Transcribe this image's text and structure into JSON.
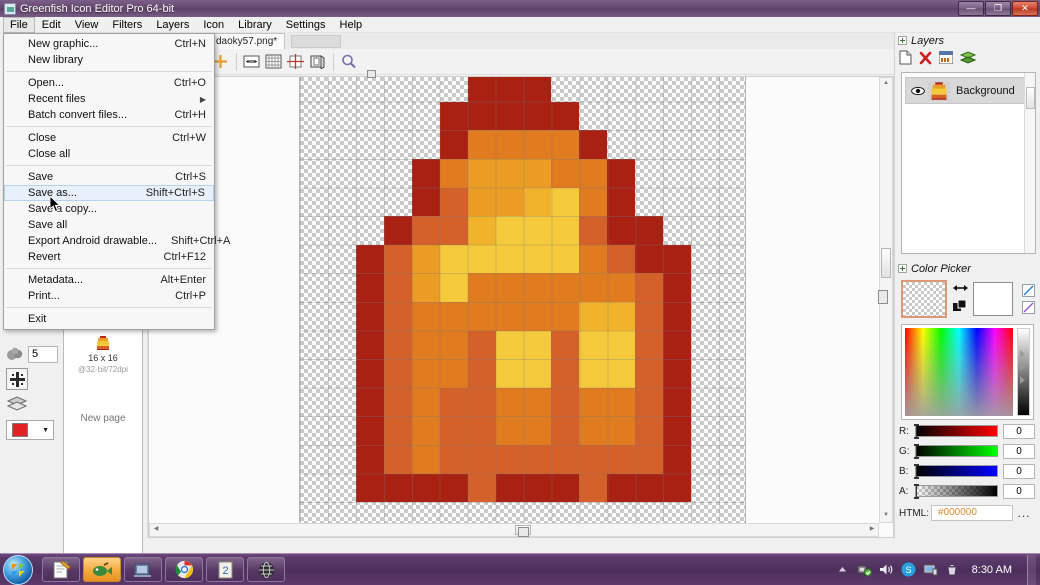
{
  "window": {
    "title": "Greenfish Icon Editor Pro 64-bit",
    "icon": "app-icon",
    "buttons": {
      "minimize": "—",
      "maximize": "❐",
      "close": "✕"
    }
  },
  "menubar": {
    "items": [
      {
        "label": "File",
        "active": true
      },
      {
        "label": "Edit",
        "active": false
      },
      {
        "label": "View",
        "active": false
      },
      {
        "label": "Filters",
        "active": false
      },
      {
        "label": "Layers",
        "active": false
      },
      {
        "label": "Icon",
        "active": false
      },
      {
        "label": "Library",
        "active": false
      },
      {
        "label": "Settings",
        "active": false
      },
      {
        "label": "Help",
        "active": false
      }
    ]
  },
  "file_menu": {
    "groups": [
      [
        {
          "label": "New graphic...",
          "shortcut": "Ctrl+N"
        },
        {
          "label": "New library",
          "shortcut": ""
        }
      ],
      [
        {
          "label": "Open...",
          "shortcut": "Ctrl+O"
        },
        {
          "label": "Recent files",
          "shortcut": "",
          "submenu": true
        },
        {
          "label": "Batch convert files...",
          "shortcut": "Ctrl+H"
        }
      ],
      [
        {
          "label": "Close",
          "shortcut": "Ctrl+W"
        },
        {
          "label": "Close all",
          "shortcut": ""
        }
      ],
      [
        {
          "label": "Save",
          "shortcut": "Ctrl+S"
        },
        {
          "label": "Save as...",
          "shortcut": "Shift+Ctrl+S",
          "selected": true
        },
        {
          "label": "Save a copy...",
          "shortcut": ""
        },
        {
          "label": "Save all",
          "shortcut": ""
        },
        {
          "label": "Export Android drawable...",
          "shortcut": "Shift+Ctrl+A"
        },
        {
          "label": "Revert",
          "shortcut": "Ctrl+F12"
        }
      ],
      [
        {
          "label": "Metadata...",
          "shortcut": "Alt+Enter"
        },
        {
          "label": "Print...",
          "shortcut": "Ctrl+P"
        }
      ],
      [
        {
          "label": "Exit",
          "shortcut": ""
        }
      ]
    ]
  },
  "document": {
    "tab_label": "daoky57.png*",
    "canvas_toolbar": [
      "crosshair-icon",
      "canvas-size-icon",
      "grid-icon",
      "guides-icon",
      "frame-icon",
      "zoom-icon"
    ]
  },
  "tool_options": {
    "brush_size_label": "brush-size",
    "brush_size_value": "5",
    "antialias_icon": "antialias-icon",
    "layers_icon": "layers-icon",
    "color_combo_swatch": "#e02222"
  },
  "page_list": {
    "thumb_icon": "page-thumbnail-icon",
    "size_label": "16 x 16",
    "depth_label": "@32-bit/72dpi",
    "new_page_label": "New page"
  },
  "layers_panel": {
    "title": "Layers",
    "tools": [
      "new-layer-icon",
      "delete-layer-icon",
      "layer-properties-icon",
      "merge-layers-icon"
    ],
    "rows": [
      {
        "name": "Background",
        "visible": true,
        "selected": true
      }
    ]
  },
  "color_picker": {
    "title": "Color Picker",
    "foreground": "transparent",
    "background": "#ffffff",
    "swap_icon": "swap-colors-icon",
    "reset_icon": "reset-colors-icon",
    "channels": [
      {
        "label": "R:",
        "value": "0",
        "color": "#ff0000"
      },
      {
        "label": "G:",
        "value": "0",
        "color": "#00ff00"
      },
      {
        "label": "B:",
        "value": "0",
        "color": "#0000ff"
      },
      {
        "label": "A:",
        "value": "0",
        "color": "#000000"
      }
    ],
    "html_label": "HTML:",
    "html_value": "#000000",
    "html_more": "..."
  },
  "taskbar": {
    "start_label": "start-orb",
    "apps": [
      {
        "name": "notepad-app",
        "active": false
      },
      {
        "name": "greenfish-app",
        "active": true
      },
      {
        "name": "media-app",
        "active": false
      },
      {
        "name": "chrome-app",
        "active": false
      },
      {
        "name": "notes-app",
        "active": false
      },
      {
        "name": "globe-app",
        "active": false
      }
    ],
    "tray": [
      "show-hidden-icons",
      "network-icon",
      "volume-icon",
      "skype-icon",
      "display-icon",
      "action-center-icon"
    ],
    "clock": "8:30 AM"
  },
  "artwork": {
    "palette": {
      "transparent": "transparent",
      "dark_red": "#a82113",
      "red": "#b9291a",
      "orange_dark": "#d4602a",
      "orange": "#e07b20",
      "orange_light": "#eb9c25",
      "amber": "#f0b32b",
      "gold": "#f5c93c",
      "yellow": "#fae84f",
      "bright_yellow": "#ffff66"
    },
    "pixels": [
      [
        "t",
        "t",
        "t",
        "t",
        "t",
        "t",
        "r",
        "r",
        "r",
        "t",
        "t",
        "t",
        "t",
        "t",
        "t",
        "t"
      ],
      [
        "t",
        "t",
        "t",
        "t",
        "t",
        "r",
        "r",
        "r",
        "r",
        "r",
        "t",
        "t",
        "t",
        "t",
        "t",
        "t"
      ],
      [
        "t",
        "t",
        "t",
        "t",
        "t",
        "r",
        "o",
        "o",
        "o",
        "o",
        "r",
        "t",
        "t",
        "t",
        "t",
        "t"
      ],
      [
        "t",
        "t",
        "t",
        "t",
        "r",
        "o",
        "L",
        "L",
        "L",
        "o",
        "o",
        "r",
        "t",
        "t",
        "t",
        "t"
      ],
      [
        "t",
        "t",
        "t",
        "t",
        "r",
        "d",
        "L",
        "L",
        "g",
        "y",
        "o",
        "r",
        "t",
        "t",
        "t",
        "t"
      ],
      [
        "t",
        "t",
        "t",
        "r",
        "d",
        "d",
        "g",
        "y",
        "y",
        "y",
        "d",
        "r",
        "r",
        "t",
        "t",
        "t"
      ],
      [
        "t",
        "t",
        "r",
        "d",
        "L",
        "y",
        "y",
        "y",
        "y",
        "y",
        "o",
        "d",
        "r",
        "r",
        "t",
        "t"
      ],
      [
        "t",
        "t",
        "r",
        "d",
        "L",
        "y",
        "o",
        "o",
        "o",
        "o",
        "o",
        "o",
        "d",
        "r",
        "t",
        "t"
      ],
      [
        "t",
        "t",
        "r",
        "d",
        "o",
        "o",
        "o",
        "o",
        "o",
        "o",
        "g",
        "g",
        "d",
        "r",
        "t",
        "t"
      ],
      [
        "t",
        "t",
        "r",
        "d",
        "o",
        "o",
        "d",
        "y",
        "y",
        "d",
        "y",
        "y",
        "d",
        "r",
        "t",
        "t"
      ],
      [
        "t",
        "t",
        "r",
        "d",
        "o",
        "o",
        "d",
        "y",
        "y",
        "d",
        "y",
        "y",
        "d",
        "r",
        "t",
        "t"
      ],
      [
        "t",
        "t",
        "r",
        "d",
        "o",
        "d",
        "d",
        "o",
        "o",
        "d",
        "o",
        "o",
        "d",
        "r",
        "t",
        "t"
      ],
      [
        "t",
        "t",
        "r",
        "d",
        "o",
        "d",
        "d",
        "o",
        "o",
        "d",
        "o",
        "o",
        "d",
        "r",
        "t",
        "t"
      ],
      [
        "t",
        "t",
        "r",
        "d",
        "o",
        "d",
        "d",
        "d",
        "d",
        "d",
        "d",
        "d",
        "d",
        "r",
        "t",
        "t"
      ],
      [
        "t",
        "t",
        "r",
        "r",
        "r",
        "r",
        "d",
        "r",
        "r",
        "r",
        "d",
        "r",
        "r",
        "r",
        "t",
        "t"
      ],
      [
        "t",
        "t",
        "t",
        "t",
        "t",
        "t",
        "t",
        "t",
        "t",
        "t",
        "t",
        "t",
        "t",
        "t",
        "t",
        "t"
      ]
    ]
  }
}
